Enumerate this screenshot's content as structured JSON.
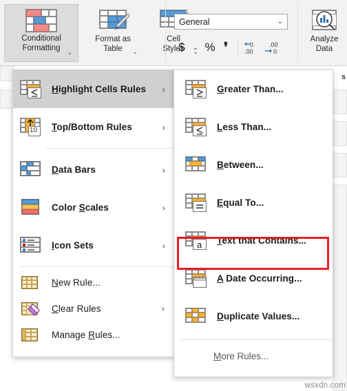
{
  "ribbon": {
    "styles_group": [
      {
        "label": "Conditional\nFormatting",
        "caret": "⌄",
        "icon": "conditional-formatting-icon",
        "active": true
      },
      {
        "label": "Format as\nTable",
        "caret": "⌄",
        "icon": "format-as-table-icon",
        "active": false
      },
      {
        "label": "Cell\nStyles",
        "caret": "⌄",
        "icon": "cell-styles-icon",
        "active": false
      }
    ],
    "number_group": {
      "format_value": "General",
      "format_chevron": "⌄",
      "buttons": [
        {
          "label": "$",
          "name": "accounting-number-format-button"
        },
        {
          "label": "⌄",
          "name": "accounting-format-dropdown"
        },
        {
          "label": "%",
          "name": "percent-style-button"
        },
        {
          "label": "❜",
          "name": "comma-style-button"
        },
        {
          "label": "0",
          "sub": ".00",
          "name": "increase-decimal-button"
        },
        {
          "label": ".00",
          "sub": "0",
          "name": "decrease-decimal-button"
        }
      ]
    },
    "analyze": {
      "label": "Analyze\nData",
      "icon": "analyze-data-icon"
    }
  },
  "main_menu": {
    "items": [
      {
        "accel": "H",
        "rest": "ighlight Cells Rules",
        "icon": "highlight-cells-rules-icon",
        "arrow": "›",
        "hover": true
      },
      {
        "accel": "T",
        "rest": "op/Bottom Rules",
        "icon": "top-bottom-rules-icon",
        "arrow": "›",
        "hover": false
      },
      {
        "accel": "D",
        "rest": "ata Bars",
        "icon": "data-bars-icon",
        "arrow": "›",
        "hover": false
      },
      {
        "accel": "S",
        "rest": "Color ",
        "pre": "Color ",
        "icon": "color-scales-icon",
        "arrow": "›",
        "hover": false,
        "label_pre": "Color ",
        "label_accel": "S",
        "label_post": "cales"
      },
      {
        "accel": "I",
        "rest": "con Sets",
        "icon": "icon-sets-icon",
        "arrow": "›",
        "hover": false
      }
    ],
    "commands": [
      {
        "label_pre": "",
        "label_accel": "N",
        "label_post": "ew Rule...",
        "icon": "new-rule-icon",
        "arrow": ""
      },
      {
        "label_pre": "",
        "label_accel": "C",
        "label_post": "lear Rules",
        "icon": "clear-rules-icon",
        "arrow": "›"
      },
      {
        "label_pre": "Manage ",
        "label_accel": "R",
        "label_post": "ules...",
        "icon": "manage-rules-icon",
        "arrow": ""
      }
    ]
  },
  "sub_menu": {
    "items": [
      {
        "label_accel": "G",
        "label_post": "reater Than...",
        "icon": "greater-than-icon",
        "boxed": false
      },
      {
        "label_accel": "L",
        "label_post": "ess Than...",
        "icon": "less-than-icon",
        "boxed": false
      },
      {
        "label_accel": "B",
        "label_post": "etween...",
        "icon": "between-icon",
        "boxed": false
      },
      {
        "label_accel": "E",
        "label_post": "qual To...",
        "icon": "equal-to-icon",
        "boxed": false
      },
      {
        "label_accel": "T",
        "label_post": "ext that Contains...",
        "icon": "text-that-contains-icon",
        "boxed": true
      },
      {
        "label_accel": "A",
        "label_post": " Date Occurring...",
        "icon": "date-occurring-icon",
        "boxed": false
      },
      {
        "label_accel": "D",
        "label_post": "uplicate Values...",
        "icon": "duplicate-values-icon",
        "boxed": false
      }
    ],
    "more": {
      "label_accel": "M",
      "label_post": "ore Rules..."
    }
  },
  "annotation": {
    "color": "#ec1c24",
    "target": "text-that-contains-menu-item"
  },
  "edge_text": "s",
  "watermark": "wsxdn.com"
}
